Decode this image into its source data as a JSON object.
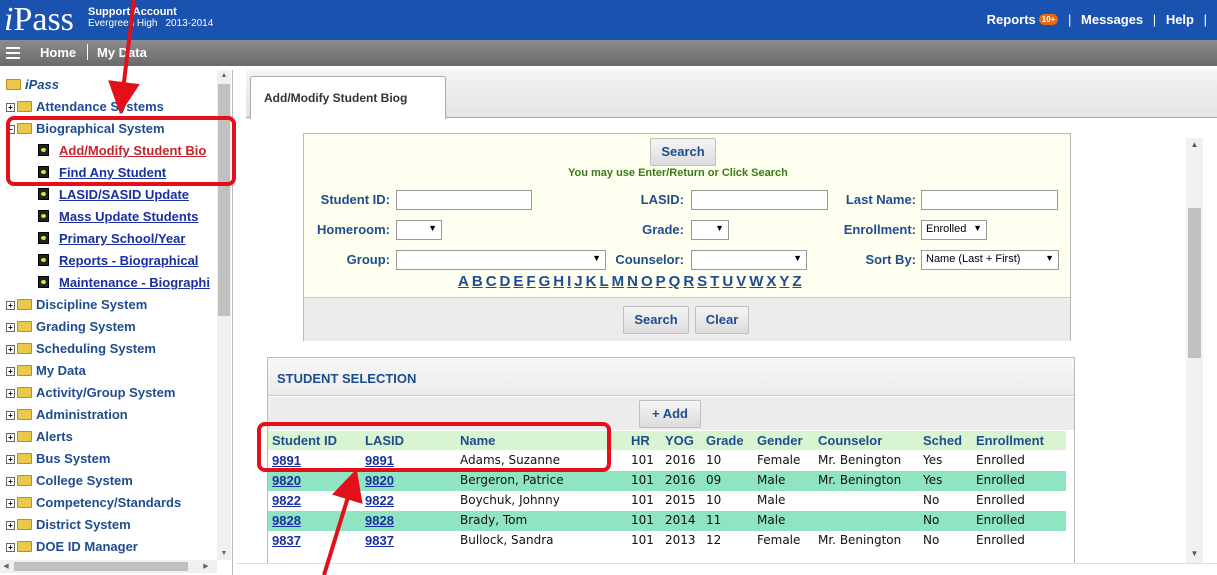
{
  "header": {
    "logo_i": "i",
    "logo_pass": "Pass",
    "account": "Support Account",
    "school": "Evergreen High",
    "year": "2013-2014",
    "reports": "Reports",
    "reports_badge": "10+",
    "messages": "Messages",
    "help": "Help",
    "sep": "|"
  },
  "nav": {
    "home": "Home",
    "mydata": "My Data"
  },
  "sidebar": {
    "root": "iPass",
    "items": [
      "Attendance Systems",
      "Biographical System",
      "Add/Modify Student Bio",
      "Find Any Student",
      "LASID/SASID Update",
      "Mass Update Students",
      "Primary School/Year",
      "Reports - Biographical",
      "Maintenance - Biographi",
      "Discipline System",
      "Grading System",
      "Scheduling System",
      "My Data",
      "Activity/Group System",
      "Administration",
      "Alerts",
      "Bus System",
      "College System",
      "Competency/Standards",
      "District System",
      "DOE ID Manager"
    ]
  },
  "tab": {
    "label": "Add/Modify Student Biog"
  },
  "search": {
    "search_label": "Search",
    "hint": "You may use Enter/Return or Click Search",
    "student_id": "Student ID:",
    "lasid": "LASID:",
    "last_name": "Last Name:",
    "homeroom": "Homeroom:",
    "grade": "Grade:",
    "enrollment": "Enrollment:",
    "enrollment_value": "Enrolled",
    "group": "Group:",
    "counselor": "Counselor:",
    "sort_by": "Sort By:",
    "sort_value": "Name (Last + First)",
    "letters": [
      "A",
      "B",
      "C",
      "D",
      "E",
      "F",
      "G",
      "H",
      "I",
      "J",
      "K",
      "L",
      "M",
      "N",
      "O",
      "P",
      "Q",
      "R",
      "S",
      "T",
      "U",
      "V",
      "W",
      "X",
      "Y",
      "Z"
    ],
    "clear_label": "Clear"
  },
  "selection": {
    "title": "STUDENT SELECTION",
    "add_label": "+ Add",
    "columns": [
      "Student ID",
      "LASID",
      "Name",
      "HR",
      "YOG",
      "Grade",
      "Gender",
      "Counselor",
      "Sched",
      "Enrollment"
    ],
    "rows": [
      [
        "9891",
        "9891",
        "Adams, Suzanne",
        "101",
        "2016",
        "10",
        "Female",
        "Mr. Benington",
        "Yes",
        "Enrolled"
      ],
      [
        "9820",
        "9820",
        "Bergeron, Patrice",
        "101",
        "2016",
        "09",
        "Male",
        "Mr. Benington",
        "Yes",
        "Enrolled"
      ],
      [
        "9822",
        "9822",
        "Boychuk, Johnny",
        "101",
        "2015",
        "10",
        "Male",
        "",
        "No",
        "Enrolled"
      ],
      [
        "9828",
        "9828",
        "Brady, Tom",
        "101",
        "2014",
        "11",
        "Male",
        "",
        "No",
        "Enrolled"
      ],
      [
        "9837",
        "9837",
        "Bullock, Sandra",
        "101",
        "2013",
        "12",
        "Female",
        "Mr. Benington",
        "No",
        "Enrolled"
      ]
    ]
  },
  "colors": {
    "header_blue": "#1a52b0",
    "annotation_red": "#e3101a",
    "row_alt": "#8fe5c2"
  }
}
